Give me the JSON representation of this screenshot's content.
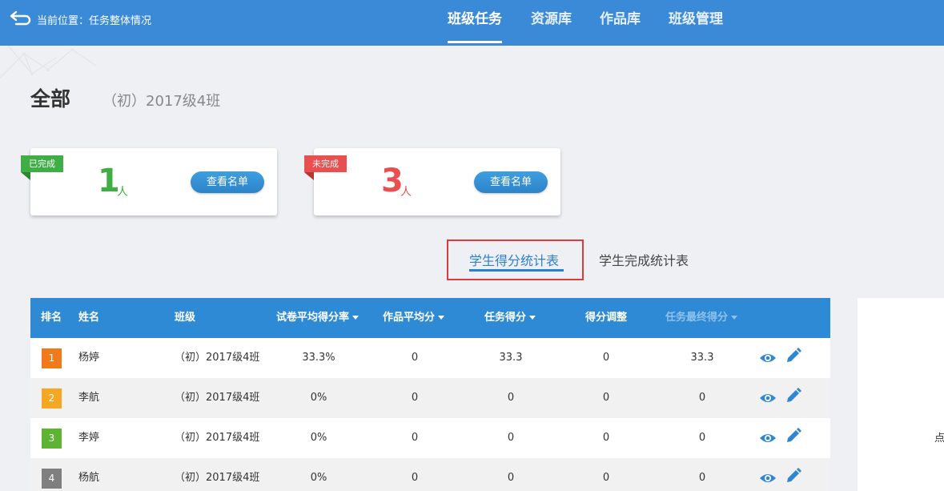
{
  "header": {
    "breadcrumb": "当前位置：任务整体情况",
    "nav": [
      {
        "label": "班级任务",
        "active": true
      },
      {
        "label": "资源库",
        "active": false
      },
      {
        "label": "作品库",
        "active": false
      },
      {
        "label": "班级管理",
        "active": false
      }
    ]
  },
  "page": {
    "title": "全部",
    "class_name": "（初）2017级4班"
  },
  "summary": [
    {
      "tag": "已完成",
      "count": "1",
      "unit": "人",
      "button": "查看名单",
      "color": "#3fae45"
    },
    {
      "tag": "未完成",
      "count": "3",
      "unit": "人",
      "button": "查看名单",
      "color": "#e94f4f"
    }
  ],
  "tabs": [
    {
      "label": "学生得分统计表",
      "active": true
    },
    {
      "label": "学生完成统计表",
      "active": false
    }
  ],
  "table": {
    "columns": [
      "排名",
      "姓名",
      "班级",
      "试卷平均得分率",
      "作品平均分",
      "任务得分",
      "得分调整",
      "任务最终得分"
    ],
    "rows": [
      {
        "rank": "1",
        "name": "杨婷",
        "class": "（初）2017级4班",
        "paper_rate": "33.3%",
        "work_avg": "0",
        "task_score": "33.3",
        "adjust": "0",
        "final": "33.3"
      },
      {
        "rank": "2",
        "name": "李航",
        "class": "（初）2017级4班",
        "paper_rate": "0%",
        "work_avg": "0",
        "task_score": "0",
        "adjust": "0",
        "final": "0"
      },
      {
        "rank": "3",
        "name": "李婷",
        "class": "（初）2017级4班",
        "paper_rate": "0%",
        "work_avg": "0",
        "task_score": "0",
        "adjust": "0",
        "final": "0"
      },
      {
        "rank": "4",
        "name": "杨航",
        "class": "（初）2017级4班",
        "paper_rate": "0%",
        "work_avg": "0",
        "task_score": "0",
        "adjust": "0",
        "final": "0"
      }
    ],
    "rank_colors": [
      "#f07a1a",
      "#f5a623",
      "#5cb432",
      "#7f7f7f"
    ],
    "header_color": "#2f8ad6"
  },
  "side_panel": {
    "text": "点"
  },
  "icons": {
    "back": "back-arrow-icon",
    "view": "eye-icon",
    "edit": "pencil-icon"
  }
}
